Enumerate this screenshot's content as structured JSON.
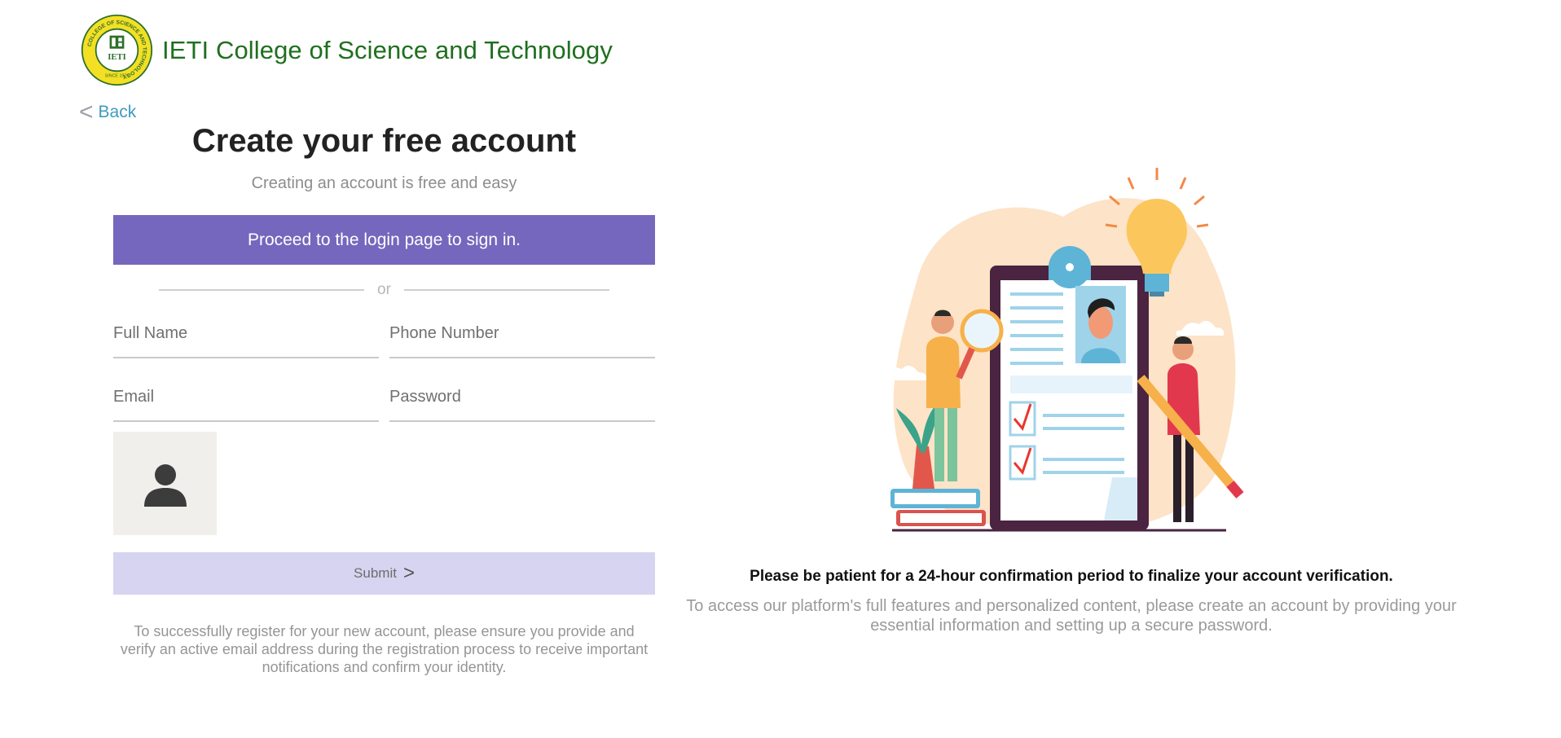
{
  "header": {
    "college_name": "IETI College of Science and Technology",
    "logo_ring_text": "COLLEGE OF SCIENCE AND TECHNOLOGY",
    "logo_center_text": "IETI",
    "logo_since_text": "SINCE 1974"
  },
  "nav": {
    "back_label": "Back"
  },
  "form": {
    "title": "Create your free account",
    "subtitle": "Creating an account is free and easy",
    "login_button_label": "Proceed to the login page to sign in.",
    "divider_text": "or",
    "full_name_placeholder": "Full Name",
    "phone_placeholder": "Phone Number",
    "email_placeholder": "Email",
    "password_placeholder": "Password",
    "submit_label": "Submit",
    "note": "To successfully register for your new account, please ensure you provide and verify an active email address during the registration process to receive important notifications and confirm your identity."
  },
  "info": {
    "patience_message": "Please be patient for a 24-hour confirmation period to finalize your account verification.",
    "description": "To access our platform's full features and personalized content, please create an account by providing your essential information and setting up a secure password."
  },
  "colors": {
    "brand_green": "#1f6f1f",
    "link_blue": "#3f9ac0",
    "primary_purple": "#7467bd",
    "submit_lavender": "#d6d4f0"
  },
  "icons": {
    "back": "chevron-left-icon",
    "submit": "chevron-right-icon",
    "avatar": "user-avatar-icon"
  }
}
